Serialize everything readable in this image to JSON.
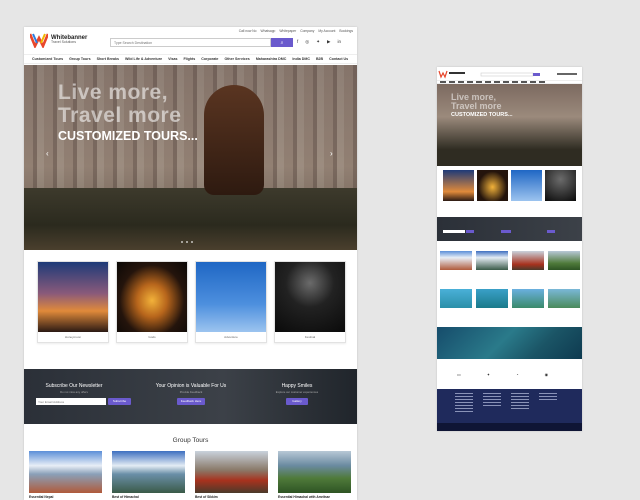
{
  "brand": {
    "title": "Whitebanner",
    "subtitle": "Travel Solutions"
  },
  "search": {
    "placeholder": "Type Search Destination",
    "button_icon": "search-icon"
  },
  "toplinks": [
    "Call now No",
    "Whatsapp",
    "Whitepaper",
    "Company",
    "My Account",
    "Bookings"
  ],
  "social": [
    "facebook-icon",
    "instagram-icon",
    "twitter-icon",
    "youtube-icon",
    "linkedin-icon"
  ],
  "nav": [
    "Customized Tours",
    "Group Tours",
    "Short Breaks",
    "Wild Life & Adventure",
    "Visas",
    "Flights",
    "Corporate",
    "Other Services",
    "Maharashtra DMC",
    "India DMC",
    "B2B",
    "Contact Us"
  ],
  "hero": {
    "line1": "Live more,",
    "line2": "Travel more",
    "line3": "CUSTOMIZED TOURS..."
  },
  "cards": [
    {
      "caption": "Honeymoon"
    },
    {
      "caption": "Gods"
    },
    {
      "caption": "Adventure"
    },
    {
      "caption": "Festival"
    }
  ],
  "newsletter": {
    "subscribe_title": "Subscribe Our Newsletter",
    "subscribe_sub": "Do not miss any offers",
    "email_placeholder": "Your Email Address",
    "subscribe_btn": "Subscribe",
    "opinion_title": "Your Opinion is Valuable For Us",
    "opinion_sub": "Provide Feedback",
    "feedback_btn": "Feedback Here",
    "smiles_title": "Happy Smiles",
    "smiles_sub": "Explore our customer experiences",
    "gallery_btn": "Gallery"
  },
  "group_tours": {
    "title": "Group Tours",
    "items": [
      {
        "name": "Essential Nepal"
      },
      {
        "name": "Best of Himachal"
      },
      {
        "name": "Best of Sikkim"
      },
      {
        "name": "Essential Himachal with Amritsar"
      }
    ]
  },
  "colors": {
    "accent": "#6a5acd",
    "footer": "#1f2a5c"
  }
}
